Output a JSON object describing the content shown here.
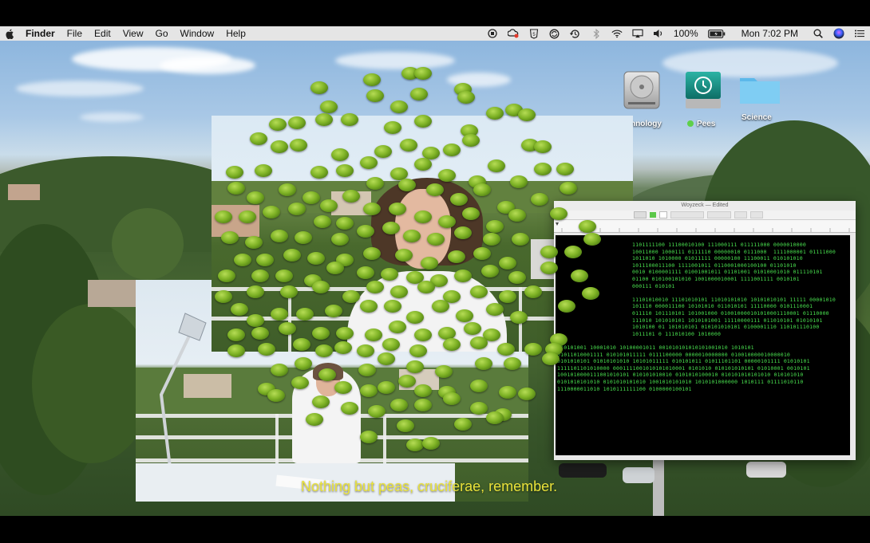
{
  "menubar": {
    "app_name": "Finder",
    "menus": [
      "File",
      "Edit",
      "View",
      "Go",
      "Window",
      "Help"
    ],
    "battery": "100%",
    "clock": "Mon 7:02 PM",
    "status_icons": [
      "record-icon",
      "creative-cloud-icon",
      "shield-5-icon",
      "sync-icon",
      "time-machine-icon",
      "bluetooth-icon",
      "wifi-icon",
      "airplay-icon",
      "volume-icon",
      "battery-icon",
      "spotlight-icon",
      "siri-icon",
      "control-center-icon"
    ]
  },
  "desktop_icons": [
    {
      "name": "hard-drive-icon",
      "label": "hnology"
    },
    {
      "name": "time-machine-disk-icon",
      "label": "Pees",
      "tag_color": "#5fd04a"
    },
    {
      "name": "folder-icon",
      "label": "Science"
    }
  ],
  "editor": {
    "title": "Woyzeck",
    "title_suffix": "— Edited",
    "text_color": "#49e04f",
    "lines": [
      "1101111100 11100010100 111000111 011111000 0000010000",
      "10011000 1000111 0111110 00000010 0111000  1111000001 01111000",
      "1011010 1010000 01011111 00000100 11100011 010101010",
      "1011100011100 1111001011 0110001000100100 01101010",
      "0010 0100001111 01001001011 01101001 01010001010 011110101",
      "01100 010100101010 1001000010001 1111001111 0010101",
      "000111 010101",
      "",
      "11101010010 11101010101 11010101010 10101010101 11111 00001010",
      "101110 000011100 10101010 011010101 11110000 0101110001",
      "011110 101110101 101001000 010010000101010001110001 01110000",
      "111010 101010101 1010101001 11110000111 011010101 01010101",
      "1010100 01 101010101 010101010101 0100001110 110101110100",
      "1011101 0 111010100 1010000",
      "",
      "010101001 10001010 10100001011 001010101010101001010 1010101",
      "01011010001111 010101011111 0111100000 0000010000000 010010000010000010",
      "0101010101 01010101010 10101011111 010101011 01011101101 00000101111 01010101",
      "1111101101010000 0001111001010101010001 0101010 010101010101 01010001 0010101",
      "1001010000111001010101 010101010010 0101010100010 010101010101010 010101010",
      "0101010101010 0101010101010 1001010101010 1010101000000 1010111 01111010110",
      "1110000011010 1010111111100 0100000100101"
    ]
  },
  "subtitle": "Nothing but peas, cruciferae, remember.",
  "pea_color": "#7fb326"
}
